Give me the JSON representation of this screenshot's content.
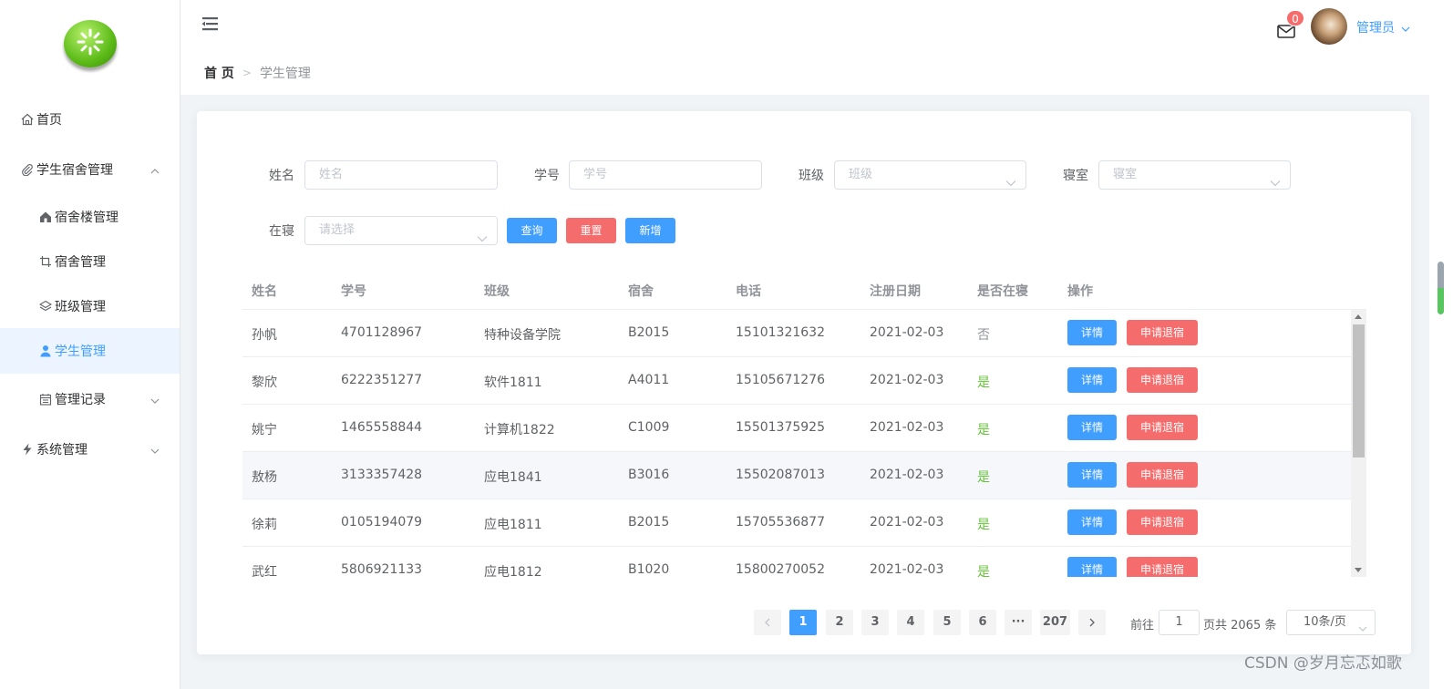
{
  "sidebar": {
    "items": [
      {
        "label": "首页"
      },
      {
        "label": "学生宿舍管理"
      },
      {
        "label": "宿舍楼管理"
      },
      {
        "label": "宿舍管理"
      },
      {
        "label": "班级管理"
      },
      {
        "label": "学生管理"
      },
      {
        "label": "管理记录"
      },
      {
        "label": "系统管理"
      }
    ]
  },
  "header": {
    "breadcrumb_home": "首 页",
    "breadcrumb_current": "学生管理",
    "mail_badge": "0",
    "user_name": "管理员"
  },
  "filters": {
    "name_label": "姓名",
    "name_placeholder": "姓名",
    "id_label": "学号",
    "id_placeholder": "学号",
    "class_label": "班级",
    "class_placeholder": "班级",
    "room_label": "寝室",
    "room_placeholder": "寝室",
    "in_dorm_label": "在寝",
    "in_dorm_placeholder": "请选择",
    "query_button": "查询",
    "reset_button": "重置",
    "add_button": "新增"
  },
  "table": {
    "headers": [
      "姓名",
      "学号",
      "班级",
      "宿舍",
      "电话",
      "注册日期",
      "是否在寝",
      "操作"
    ],
    "detail_label": "详情",
    "checkout_label": "申请退宿",
    "rows": [
      {
        "name": "孙帆",
        "id": "4701128967",
        "class": "特种设备学院",
        "room": "B2015",
        "phone": "15101321632",
        "date": "2021-02-03",
        "in": "否"
      },
      {
        "name": "黎欣",
        "id": "6222351277",
        "class": "软件1811",
        "room": "A4011",
        "phone": "15105671276",
        "date": "2021-02-03",
        "in": "是"
      },
      {
        "name": "姚宁",
        "id": "1465558844",
        "class": "计算机1822",
        "room": "C1009",
        "phone": "15501375925",
        "date": "2021-02-03",
        "in": "是"
      },
      {
        "name": "敖杨",
        "id": "3133357428",
        "class": "应电1841",
        "room": "B3016",
        "phone": "15502087013",
        "date": "2021-02-03",
        "in": "是"
      },
      {
        "name": "徐莉",
        "id": "0105194079",
        "class": "应电1811",
        "room": "B2015",
        "phone": "15705536877",
        "date": "2021-02-03",
        "in": "是"
      },
      {
        "name": "武红",
        "id": "5806921133",
        "class": "应电1812",
        "room": "B1020",
        "phone": "15800270052",
        "date": "2021-02-03",
        "in": "是"
      }
    ]
  },
  "pagination": {
    "pages": [
      "1",
      "2",
      "3",
      "4",
      "5",
      "6",
      "···",
      "207"
    ],
    "goto_prefix": "前往",
    "goto_value": "1",
    "goto_suffix": "页共 2065 条",
    "page_size": "10条/页"
  },
  "watermark": "CSDN @岁月忘忑如歌",
  "colors": {
    "primary": "#409eff",
    "danger": "#f56c6c",
    "success": "#67c23a"
  }
}
